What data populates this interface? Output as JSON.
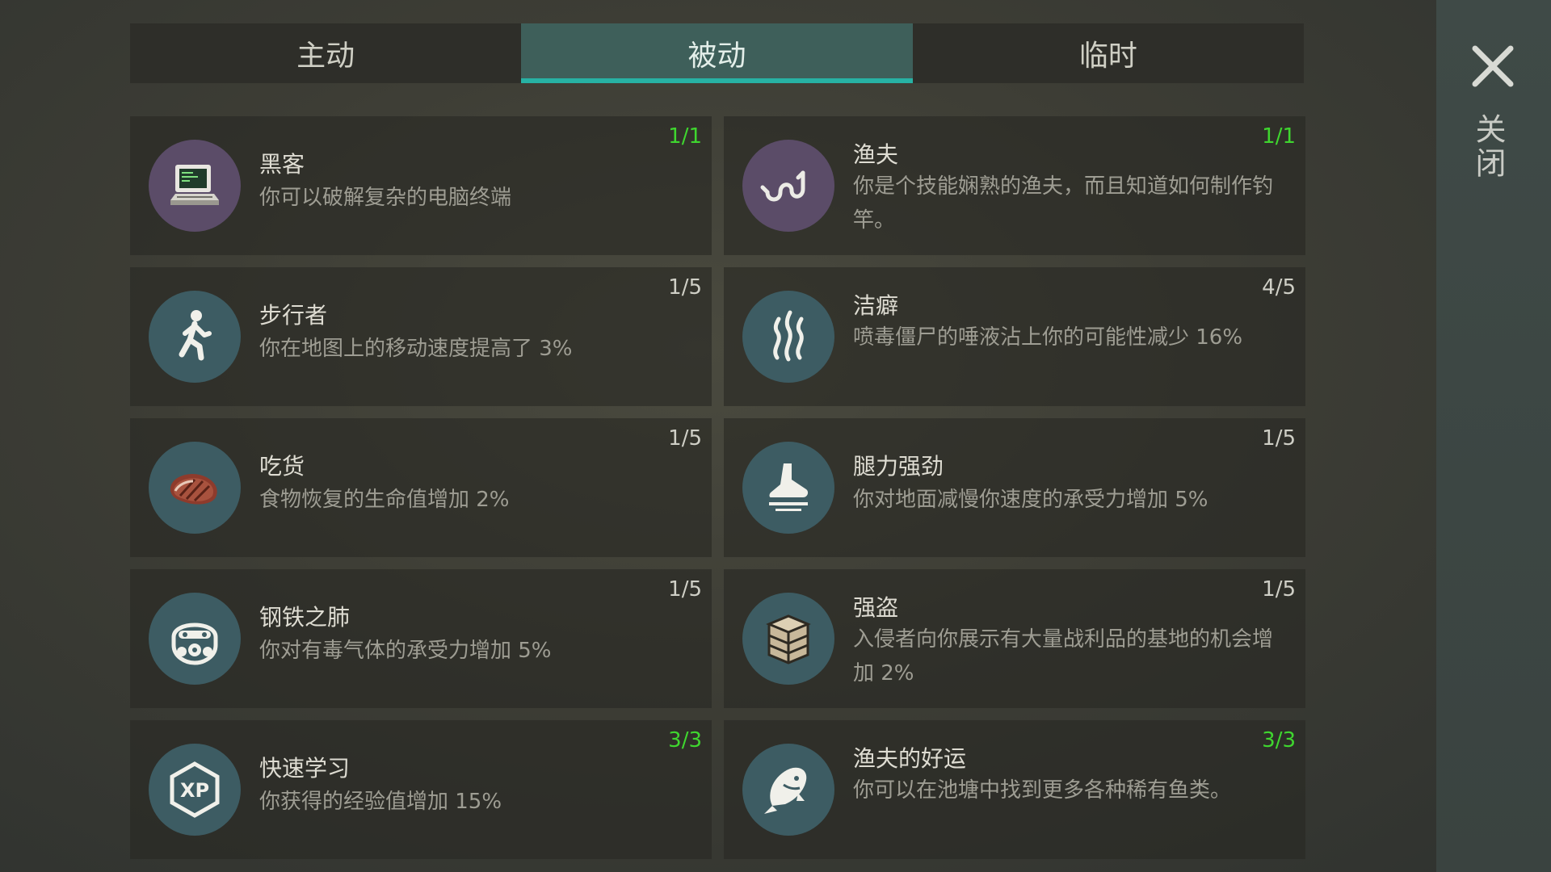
{
  "tabs": [
    {
      "label": "主动",
      "active": false
    },
    {
      "label": "被动",
      "active": true
    },
    {
      "label": "临时",
      "active": false
    }
  ],
  "close": {
    "label": "关闭"
  },
  "perks": [
    {
      "name": "黑客",
      "desc": "你可以破解复杂的电脑终端",
      "level": "1/1",
      "maxed": true,
      "icon": "computer-icon"
    },
    {
      "name": "渔夫",
      "desc": "你是个技能娴熟的渔夫，而且知道如何制作钓竿。",
      "level": "1/1",
      "maxed": true,
      "icon": "fishing-hook-icon"
    },
    {
      "name": "步行者",
      "desc": "你在地图上的移动速度提高了 3%",
      "level": "1/5",
      "maxed": false,
      "icon": "walking-person-icon"
    },
    {
      "name": "洁癖",
      "desc": "喷毒僵尸的唾液沾上你的可能性减少 16%",
      "level": "4/5",
      "maxed": false,
      "icon": "steam-icon"
    },
    {
      "name": "吃货",
      "desc": "食物恢复的生命值增加 2%",
      "level": "1/5",
      "maxed": false,
      "icon": "steak-icon"
    },
    {
      "name": "腿力强劲",
      "desc": "你对地面减慢你速度的承受力增加 5%",
      "level": "1/5",
      "maxed": false,
      "icon": "boot-icon"
    },
    {
      "name": "钢铁之肺",
      "desc": "你对有毒气体的承受力增加 5%",
      "level": "1/5",
      "maxed": false,
      "icon": "gas-mask-icon"
    },
    {
      "name": "强盗",
      "desc": "入侵者向你展示有大量战利品的基地的机会增加 2%",
      "level": "1/5",
      "maxed": false,
      "icon": "crate-icon"
    },
    {
      "name": "快速学习",
      "desc": "你获得的经验值增加 15%",
      "level": "3/3",
      "maxed": true,
      "icon": "xp-icon"
    },
    {
      "name": "渔夫的好运",
      "desc": "你可以在池塘中找到更多各种稀有鱼类。",
      "level": "3/3",
      "maxed": true,
      "icon": "fish-icon"
    }
  ]
}
